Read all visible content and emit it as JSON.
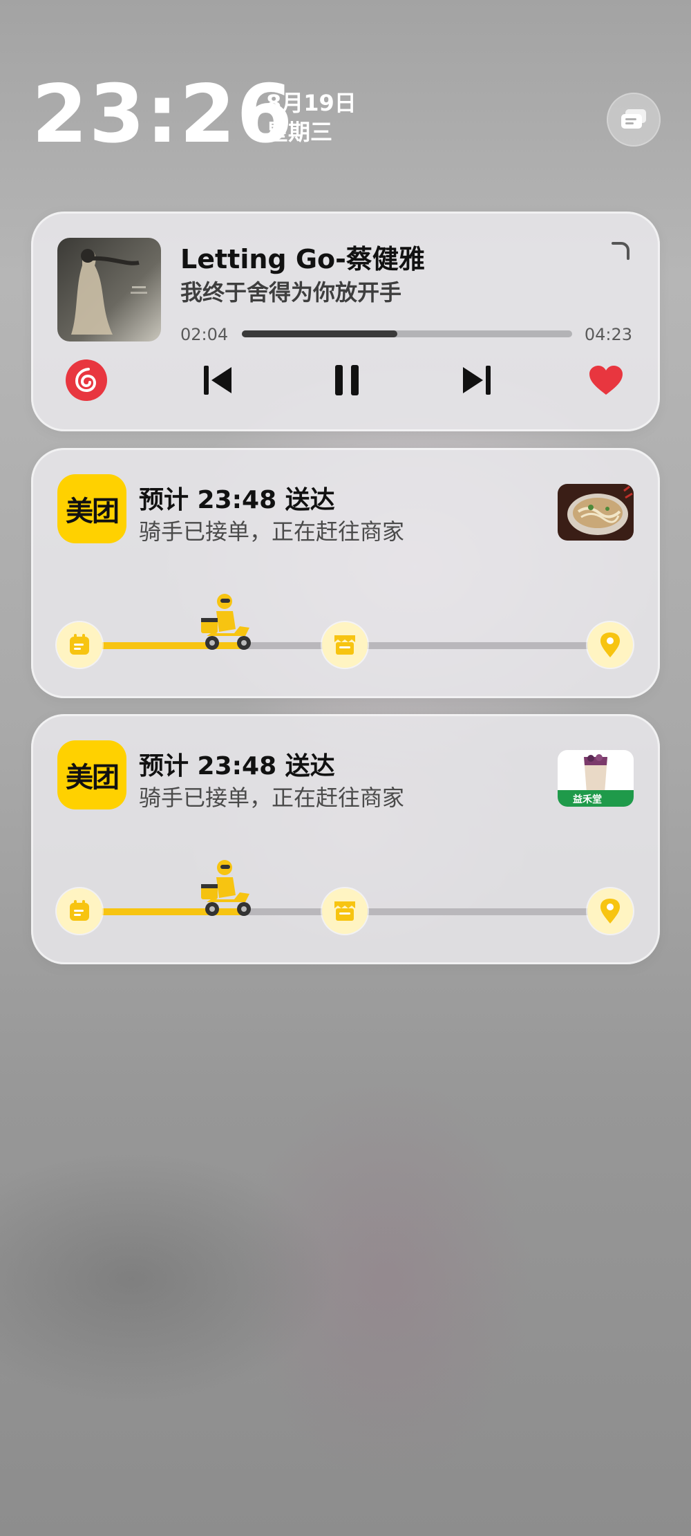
{
  "lockscreen": {
    "time": "23:26",
    "date": "8月19日",
    "weekday": "星期三"
  },
  "music": {
    "title": "Letting Go-蔡健雅",
    "lyric": "我终于舍得为你放开手",
    "current_time": "02:04",
    "total_time": "04:23",
    "progress": 0.47,
    "icons": {
      "app": "netease-cloud-music-icon",
      "previous": "skip-previous-icon",
      "pause": "pause-icon",
      "next": "skip-next-icon",
      "like": "heart-icon",
      "expand": "expand-corner-icon"
    },
    "colors": {
      "accent": "#e8363f",
      "text": "#111111"
    }
  },
  "deliveries": [
    {
      "app_logo": "美团",
      "eta": "预计 23:48 送达",
      "status": "骑手已接单，正在赶往商家",
      "progress": 0.3,
      "thumbnail": "noodle-soup-image"
    },
    {
      "app_logo": "美团",
      "eta": "预计 23:48 送达",
      "status": "骑手已接单，正在赶往商家",
      "progress": 0.3,
      "thumbnail": "milk-tea-image",
      "thumbnail_text": "益禾堂"
    }
  ],
  "colors": {
    "meituan_yellow": "#ffd100",
    "track_fill": "#f7c411"
  }
}
